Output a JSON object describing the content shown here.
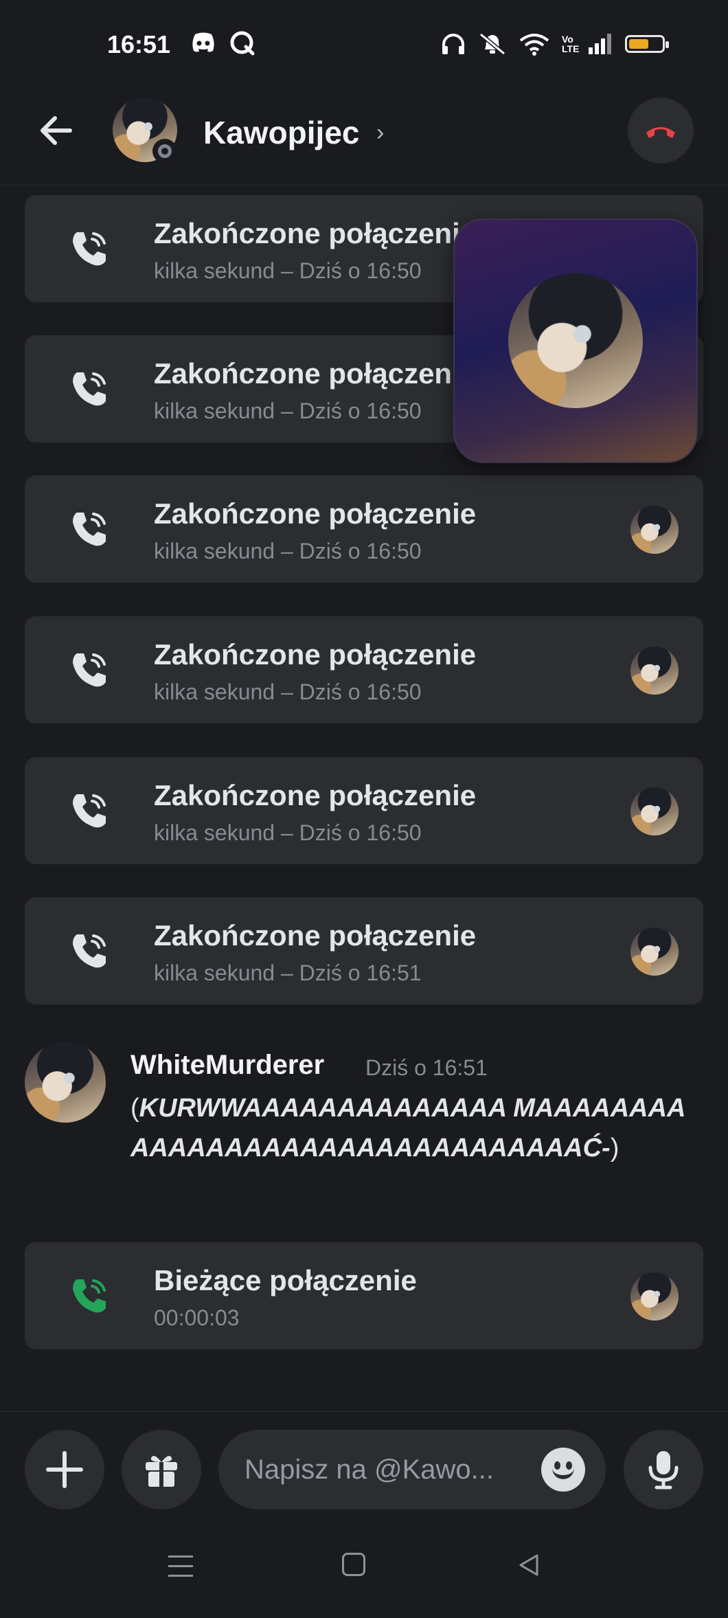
{
  "status_bar": {
    "time": "16:51",
    "left_icons": [
      "discord-icon",
      "q-app-icon"
    ],
    "right_icons": [
      "headphones-icon",
      "silent-bell-icon",
      "wifi-icon",
      "volte-icon",
      "signal-icon",
      "battery-icon"
    ],
    "volte_text": "Vo LTE",
    "battery_level": 0.6,
    "battery_color": "#e9a920"
  },
  "header": {
    "title": "Kawopijec",
    "chevron": "›",
    "hangup_color": "#ed4245"
  },
  "calls": [
    {
      "title": "Zakończone połączenie",
      "subtitle": "kilka sekund – Dziś o 16:50"
    },
    {
      "title": "Zakończone połączenie",
      "subtitle": "kilka sekund – Dziś o 16:50"
    },
    {
      "title": "Zakończone połączenie",
      "subtitle": "kilka sekund – Dziś o 16:50"
    },
    {
      "title": "Zakończone połączenie",
      "subtitle": "kilka sekund – Dziś o 16:50"
    },
    {
      "title": "Zakończone połączenie",
      "subtitle": "kilka sekund – Dziś o 16:50"
    },
    {
      "title": "Zakończone połączenie",
      "subtitle": "kilka sekund – Dziś o 16:51"
    }
  ],
  "message": {
    "author": "WhiteMurderer",
    "time": "Dziś o 16:51",
    "open_paren": "(",
    "text": "KURWWAAAAAAAAAAAAAA MAAAAAAAAAAAAAAAAAAAAAAAAAAAAAAAAĆ-",
    "close_paren": ")"
  },
  "current_call": {
    "title": "Bieżące połączenie",
    "duration": "00:00:03",
    "icon_color": "#23a55a"
  },
  "composer": {
    "placeholder": "Napisz na @Kawo..."
  }
}
